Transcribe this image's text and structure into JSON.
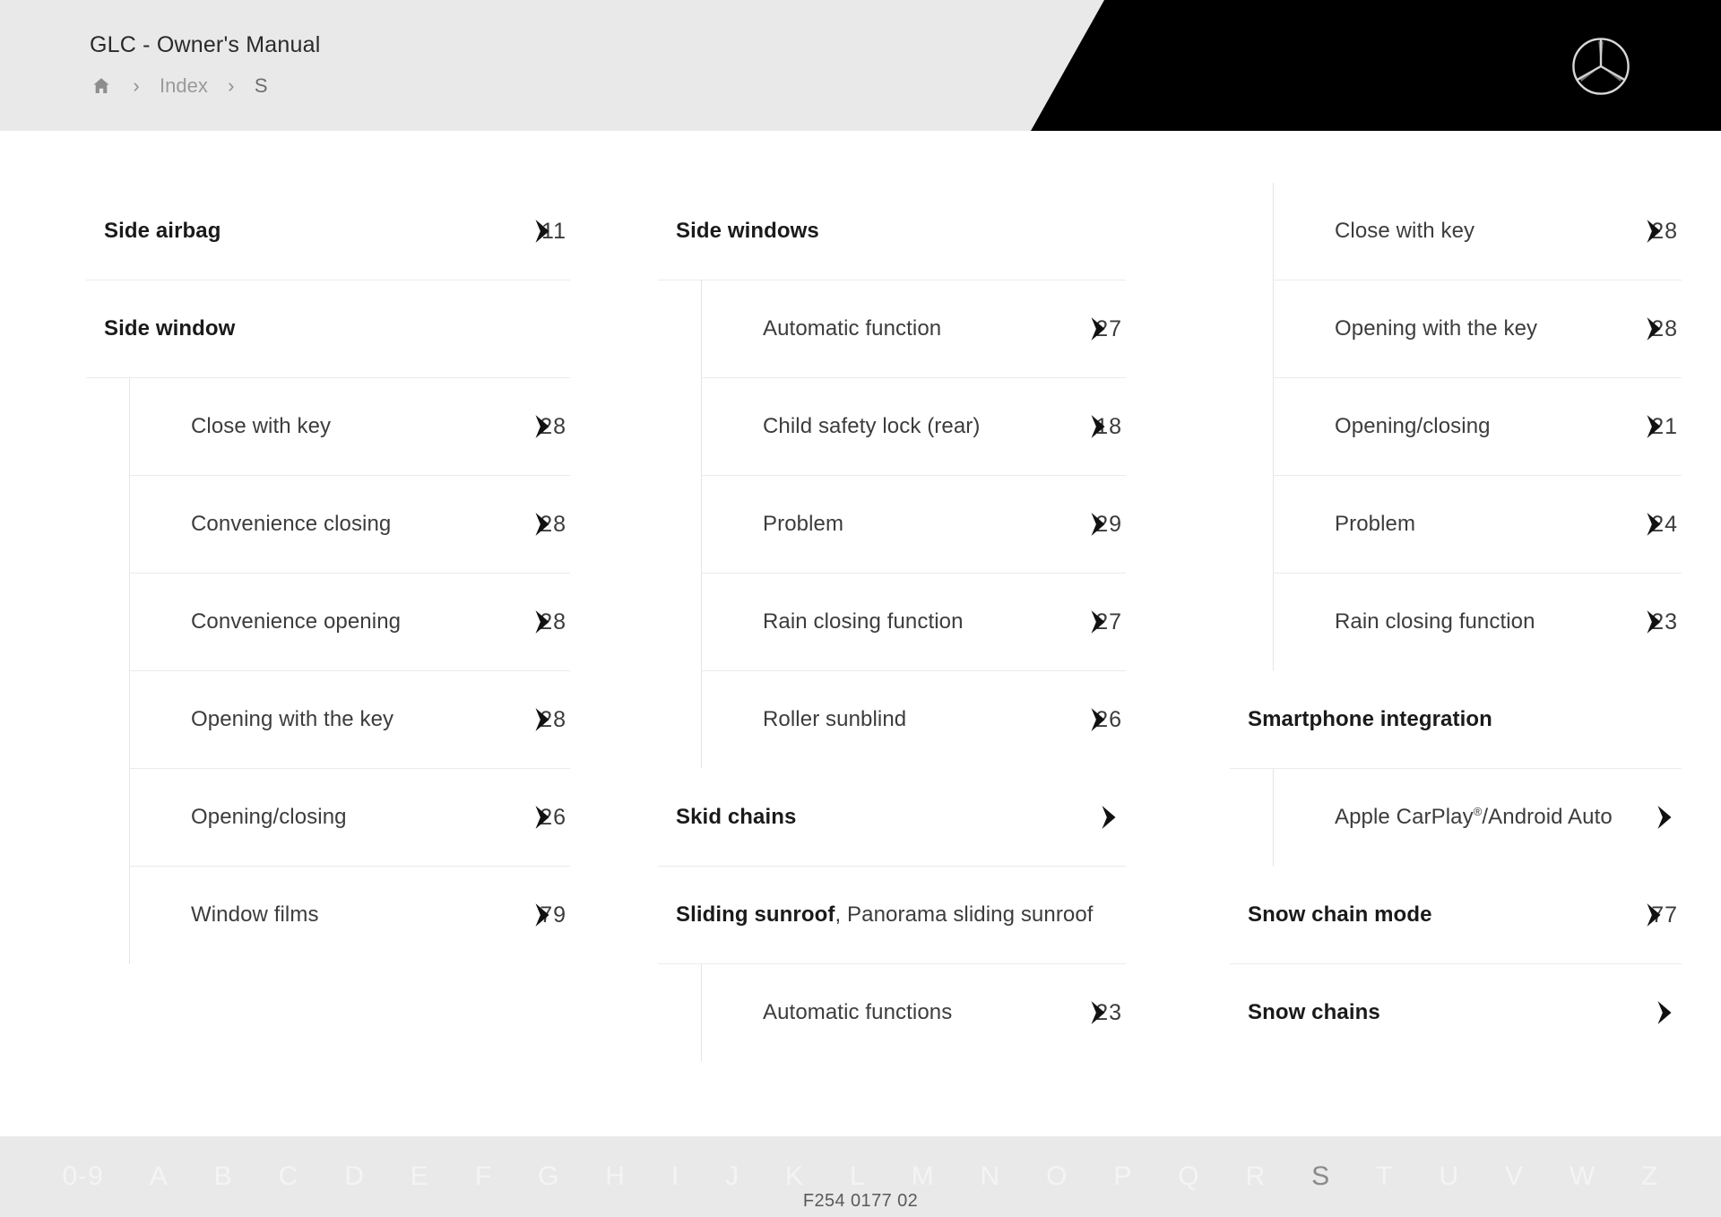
{
  "header": {
    "title": "GLC - Owner's Manual",
    "breadcrumb": {
      "home_icon": "home-icon",
      "separator": "›",
      "items": [
        "Index",
        "S"
      ]
    },
    "logo": "mercedes-benz-star-logo"
  },
  "columns": [
    {
      "groups": [
        {
          "heading": {
            "label": "Side airbag",
            "label_bold": "Side airbag",
            "label_rest": "",
            "pageref": "1 1",
            "pageref_digits_left": "1",
            "pageref_digits_right": "1",
            "icon": "jump-to-page-icon"
          },
          "items": []
        },
        {
          "heading": {
            "label": "Side window",
            "label_bold": "Side window",
            "label_rest": "",
            "pageref": "",
            "pageref_digits_left": "",
            "pageref_digits_right": "",
            "icon": ""
          },
          "items": [
            {
              "label": "Close with key",
              "pageref_digits_left": "2",
              "pageref_digits_right": "8",
              "icon": "jump-to-page-icon"
            },
            {
              "label": "Convenience closing",
              "pageref_digits_left": "2",
              "pageref_digits_right": "8",
              "icon": "jump-to-page-icon"
            },
            {
              "label": "Convenience opening",
              "pageref_digits_left": "2",
              "pageref_digits_right": "8",
              "icon": "jump-to-page-icon"
            },
            {
              "label": "Opening with the key",
              "pageref_digits_left": "2",
              "pageref_digits_right": "8",
              "icon": "jump-to-page-icon"
            },
            {
              "label": "Opening/closing",
              "pageref_digits_left": "2",
              "pageref_digits_right": "6",
              "icon": "jump-to-page-icon"
            },
            {
              "label": "Window films",
              "pageref_digits_left": "7",
              "pageref_digits_right": "9",
              "icon": "jump-to-page-icon"
            }
          ]
        }
      ]
    },
    {
      "groups": [
        {
          "heading": {
            "label": "Side windows",
            "label_bold": "Side windows",
            "label_rest": "",
            "pageref_digits_left": "",
            "pageref_digits_right": "",
            "icon": ""
          },
          "items": [
            {
              "label": "Automatic function",
              "pageref_digits_left": "2",
              "pageref_digits_right": "7",
              "icon": "jump-to-page-icon"
            },
            {
              "label": "Child safety lock (rear)",
              "pageref_digits_left": "1",
              "pageref_digits_right": "8",
              "icon": "jump-to-page-icon"
            },
            {
              "label": "Problem",
              "pageref_digits_left": "2",
              "pageref_digits_right": "9",
              "icon": "jump-to-page-icon"
            },
            {
              "label": "Rain closing function",
              "pageref_digits_left": "2",
              "pageref_digits_right": "7",
              "icon": "jump-to-page-icon"
            },
            {
              "label": "Roller sunblind",
              "pageref_digits_left": "2",
              "pageref_digits_right": "6",
              "icon": "jump-to-page-icon"
            }
          ]
        },
        {
          "heading": {
            "label": "Skid chains",
            "label_bold": "Skid chains",
            "label_rest": "",
            "pageref_digits_left": "",
            "pageref_digits_right": "",
            "icon": "jump-to-page-icon"
          },
          "items": []
        },
        {
          "heading": {
            "label": "Sliding sunroof, Panorama sliding sunroof",
            "label_bold": "Sliding sunroof",
            "label_rest": ", Panorama sliding sunroof",
            "pageref_digits_left": "",
            "pageref_digits_right": "",
            "icon": ""
          },
          "items": [
            {
              "label": "Automatic functions",
              "pageref_digits_left": "2",
              "pageref_digits_right": "3",
              "icon": "jump-to-page-icon"
            }
          ]
        }
      ]
    },
    {
      "groups": [
        {
          "heading": null,
          "items": [
            {
              "label": "Close with key",
              "pageref_digits_left": "2",
              "pageref_digits_right": "8",
              "icon": "jump-to-page-icon"
            },
            {
              "label": "Opening with the key",
              "pageref_digits_left": "2",
              "pageref_digits_right": "8",
              "icon": "jump-to-page-icon"
            },
            {
              "label": "Opening/closing",
              "pageref_digits_left": "2",
              "pageref_digits_right": "1",
              "icon": "jump-to-page-icon"
            },
            {
              "label": "Problem",
              "pageref_digits_left": "2",
              "pageref_digits_right": "4",
              "icon": "jump-to-page-icon"
            },
            {
              "label": "Rain closing function",
              "pageref_digits_left": "2",
              "pageref_digits_right": "3",
              "icon": "jump-to-page-icon"
            }
          ]
        },
        {
          "heading": {
            "label": "Smartphone integration",
            "label_bold": "Smartphone integration",
            "label_rest": "",
            "pageref_digits_left": "",
            "pageref_digits_right": "",
            "icon": ""
          },
          "items": [
            {
              "label": "Apple CarPlay®/Android Auto",
              "label_main": "Apple CarPlay",
              "label_sup": "®",
              "label_tail": "/Android Auto",
              "pageref_digits_left": "",
              "pageref_digits_right": "",
              "icon": "jump-to-page-icon"
            }
          ]
        },
        {
          "heading": {
            "label": "Snow chain mode",
            "label_bold": "Snow chain mode",
            "label_rest": "",
            "pageref_digits_left": "7",
            "pageref_digits_right": "7",
            "icon": "jump-to-page-icon"
          },
          "items": []
        },
        {
          "heading": {
            "label": "Snow chains",
            "label_bold": "Snow chains",
            "label_rest": "",
            "pageref_digits_left": "",
            "pageref_digits_right": "",
            "icon": "jump-to-page-icon"
          },
          "items": []
        }
      ]
    }
  ],
  "footer": {
    "alphabet": [
      "0-9",
      "A",
      "B",
      "C",
      "D",
      "E",
      "F",
      "G",
      "H",
      "I",
      "J",
      "K",
      "L",
      "M",
      "N",
      "O",
      "P",
      "Q",
      "R",
      "S",
      "T",
      "U",
      "V",
      "W",
      "Z"
    ],
    "active_letter": "S",
    "doc_code": "F254 0177 02"
  }
}
